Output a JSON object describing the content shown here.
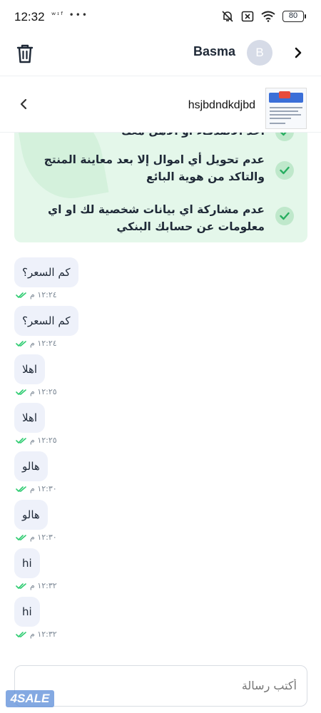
{
  "status_bar": {
    "time": "12:32",
    "left_icons": "ʷᶦᶠ •••",
    "battery": "80"
  },
  "header": {
    "name": "Basma",
    "avatar_initial": "B"
  },
  "product": {
    "title": "hsjbdndkdjbd"
  },
  "tips": {
    "items": [
      "أخذ الأصدقاء أو الأهل معك",
      "عدم تحويل أي اموال إلا بعد معاينة المنتج والتاكد من هوية البائع",
      "عدم مشاركة اي بيانات شخصية لك او اي معلومات عن حسابك البنكي"
    ]
  },
  "messages": [
    {
      "text": "كم السعر؟",
      "time": "١٢:٢٤ م"
    },
    {
      "text": "كم السعر؟",
      "time": "١٢:٢٤ م"
    },
    {
      "text": "اهلا",
      "time": "١٢:٢٥ م"
    },
    {
      "text": "اهلا",
      "time": "١٢:٢٥ م"
    },
    {
      "text": "هالو",
      "time": "١٢:٣٠ م"
    },
    {
      "text": "هالو",
      "time": "١٢:٣٠ م"
    },
    {
      "text": "hi",
      "time": "١٢:٣٢ م"
    },
    {
      "text": "hi",
      "time": "١٢:٣٢ م"
    }
  ],
  "composer": {
    "placeholder": "أكتب رسالة"
  },
  "brand": {
    "logo_text": "4SALE"
  },
  "colors": {
    "tip_background": "#e4f7ea",
    "check_green": "#27ae60",
    "bubble": "#eef1fa",
    "read_tick": "#2ecc71"
  }
}
